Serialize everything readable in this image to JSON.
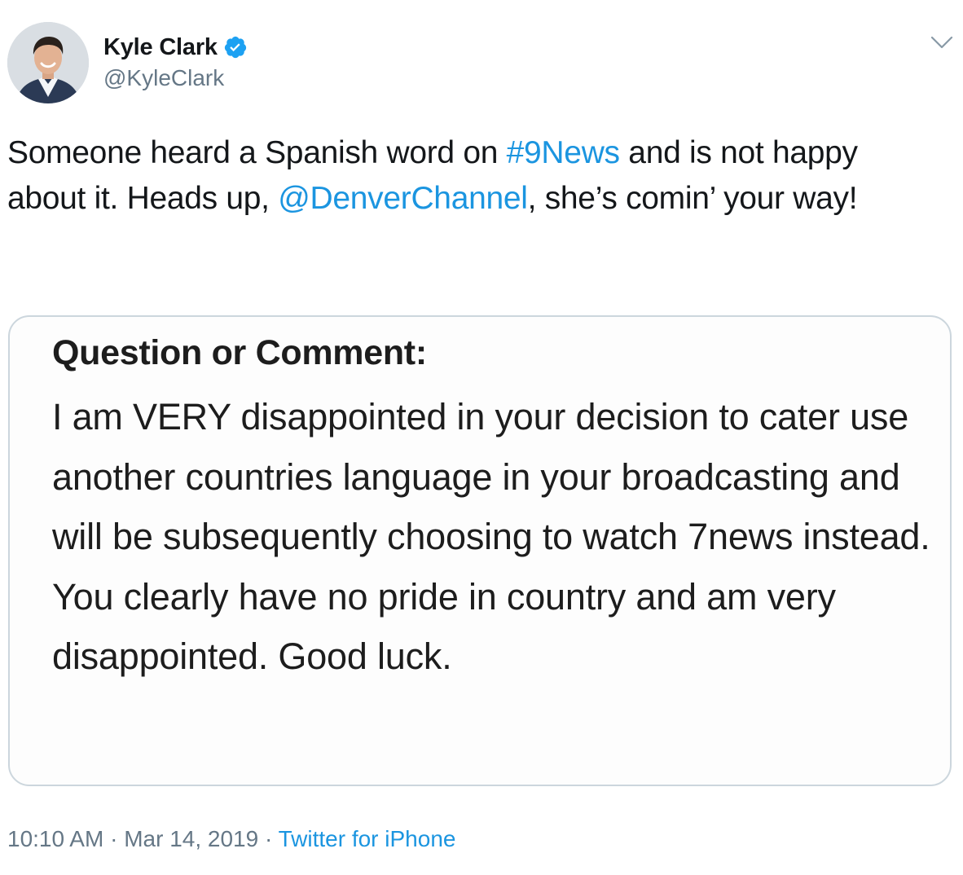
{
  "author": {
    "display_name": "Kyle Clark",
    "handle": "@KyleClark",
    "verified": true,
    "avatar_icon": "profile-photo"
  },
  "tweet": {
    "text_parts": [
      "Someone heard a Spanish word on ",
      "#9News",
      " and is not happy about it. Heads up, ",
      "@DenverChannel",
      ", she’s comin’ your way!"
    ]
  },
  "media": {
    "heading": "Question or Comment:",
    "body": "I am VERY disappointed in your decision to cater use another countries language in your broadcasting and will be subsequently choosing to watch 7news instead. You clearly have no pride in country and am very disappointed. Good luck."
  },
  "meta": {
    "time": "10:10 AM",
    "separator": "·",
    "date": "Mar 14, 2019",
    "source": "Twitter for iPhone"
  },
  "colors": {
    "link": "#1b95e0",
    "secondary_text": "#657786",
    "verified_badge": "#1da1f2",
    "card_border": "#ccd6dd"
  },
  "icons": {
    "verified": "verified-badge-icon",
    "menu": "chevron-down-icon"
  }
}
